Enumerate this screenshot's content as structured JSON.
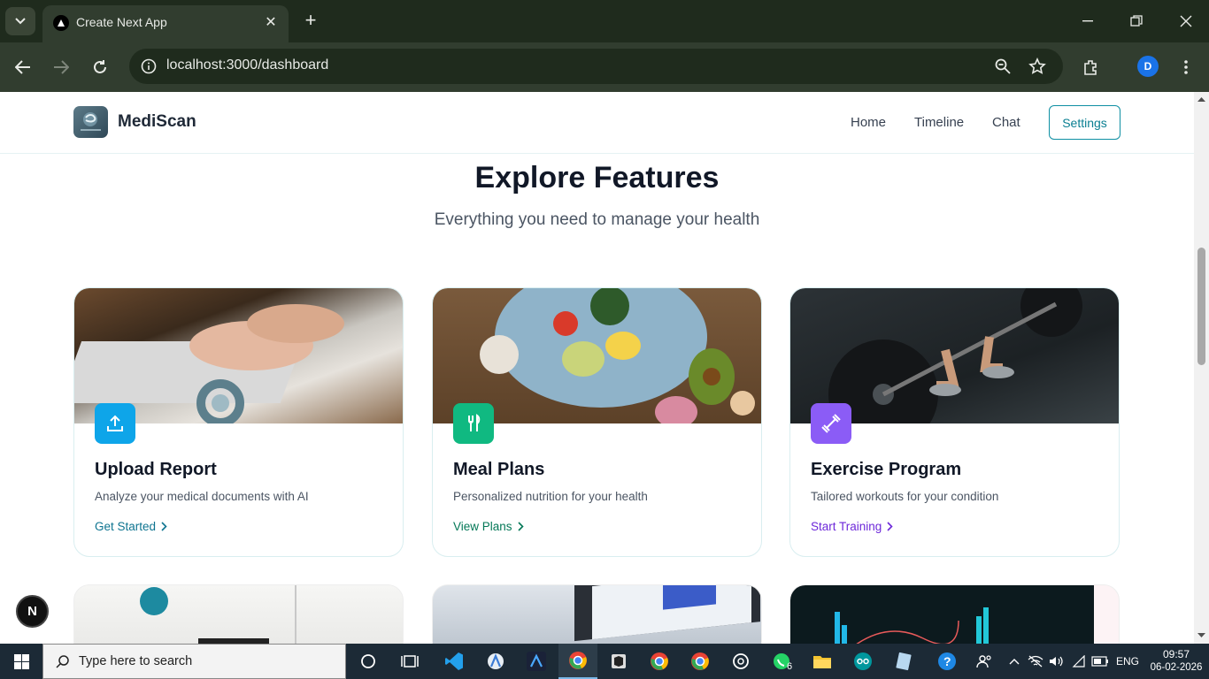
{
  "browser": {
    "tab_title": "Create Next App",
    "url": "localhost:3000/dashboard",
    "profile_initial": "D"
  },
  "header": {
    "brand": "MediScan",
    "nav": [
      "Home",
      "Timeline",
      "Chat"
    ],
    "settings_label": "Settings"
  },
  "section": {
    "title": "Explore Features",
    "subtitle": "Everything you need to manage your health"
  },
  "cards": [
    {
      "title": "Upload Report",
      "desc": "Analyze your medical documents with AI",
      "link": "Get Started",
      "accent": "#0ea5e9",
      "link_color": "#0e7490",
      "icon": "upload-icon"
    },
    {
      "title": "Meal Plans",
      "desc": "Personalized nutrition for your health",
      "link": "View Plans",
      "accent": "#10b981",
      "link_color": "#047857",
      "icon": "fork-knife-icon"
    },
    {
      "title": "Exercise Program",
      "desc": "Tailored workouts for your condition",
      "link": "Start Training",
      "accent": "#8b5cf6",
      "link_color": "#6d28d9",
      "icon": "dumbbell-icon"
    }
  ],
  "dev_badge": "N",
  "taskbar": {
    "search_placeholder": "Type here to search",
    "badge_count": "6",
    "language": "ENG",
    "time": "09:57",
    "date": "06-02-2026"
  }
}
